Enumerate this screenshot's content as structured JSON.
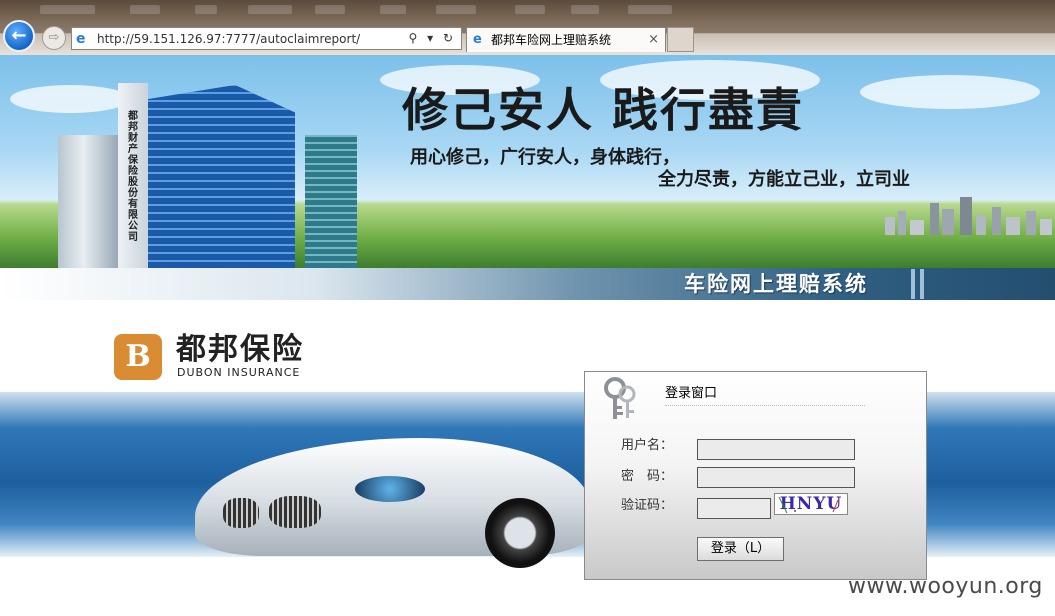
{
  "browser": {
    "address_url": "http://59.151.126.97:7777/autoclaimreport/",
    "tab_title": "都邦车险网上理赔系统",
    "tab_close": "×",
    "back_glyph": "←",
    "forward_glyph": "⇨",
    "address_tools": "⚲ ▾ ↻"
  },
  "banner": {
    "building_sign": "都邦财产保险股份有限公司",
    "slogan_main": "修己安人 践行盡責",
    "slogan_line1": "用心修己，广行安人，身体践行，",
    "slogan_line2": "全力尽责，方能立己业，立司业",
    "system_title": "车险网上理赔系统"
  },
  "brand": {
    "logo_glyph": "B",
    "name_cn": "都邦保险",
    "name_en": "DUBON INSURANCE",
    "accent_color": "#d98c32"
  },
  "login": {
    "title": "登录窗口",
    "username_label": "用户名：",
    "password_label": "密　码：",
    "captcha_label": "验证码：",
    "username_value": "",
    "password_value": "",
    "captcha_value": "",
    "captcha_image_text": "HNYU",
    "submit_label": "登录（L）"
  },
  "watermark": "www.wooyun.org"
}
